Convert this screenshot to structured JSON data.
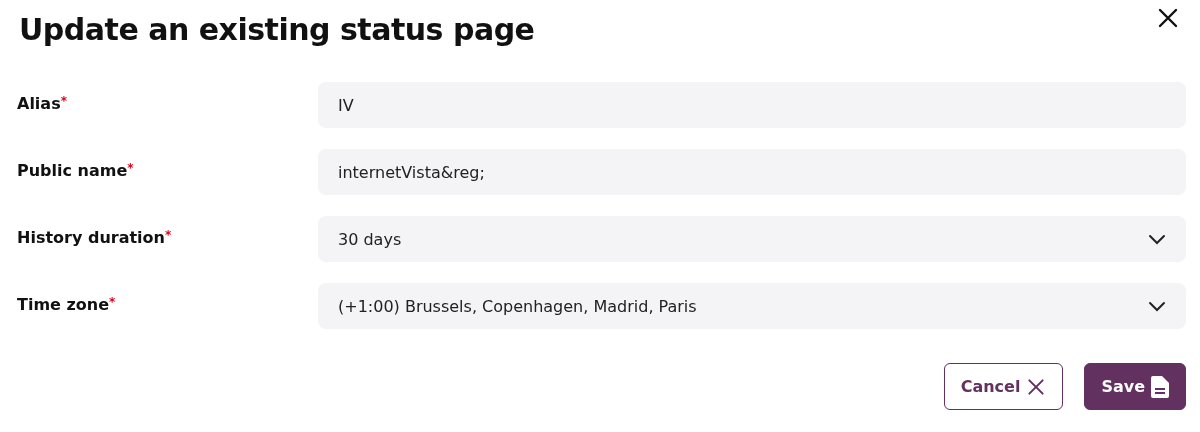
{
  "dialog": {
    "title": "Update an existing status page"
  },
  "fields": [
    {
      "label": "Alias",
      "required_mark": "*",
      "kind": "text",
      "value": "IV"
    },
    {
      "label": "Public name",
      "required_mark": "*",
      "kind": "text",
      "value": "internetVista&reg;"
    },
    {
      "label": "History duration",
      "required_mark": "*",
      "kind": "select",
      "value": "30 days"
    },
    {
      "label": "Time zone",
      "required_mark": "*",
      "kind": "select",
      "value": "(+1:00) Brussels, Copenhagen, Madrid, Paris"
    }
  ],
  "buttons": [
    {
      "label": "Cancel",
      "kind": "secondary"
    },
    {
      "label": "Save",
      "kind": "primary"
    }
  ]
}
